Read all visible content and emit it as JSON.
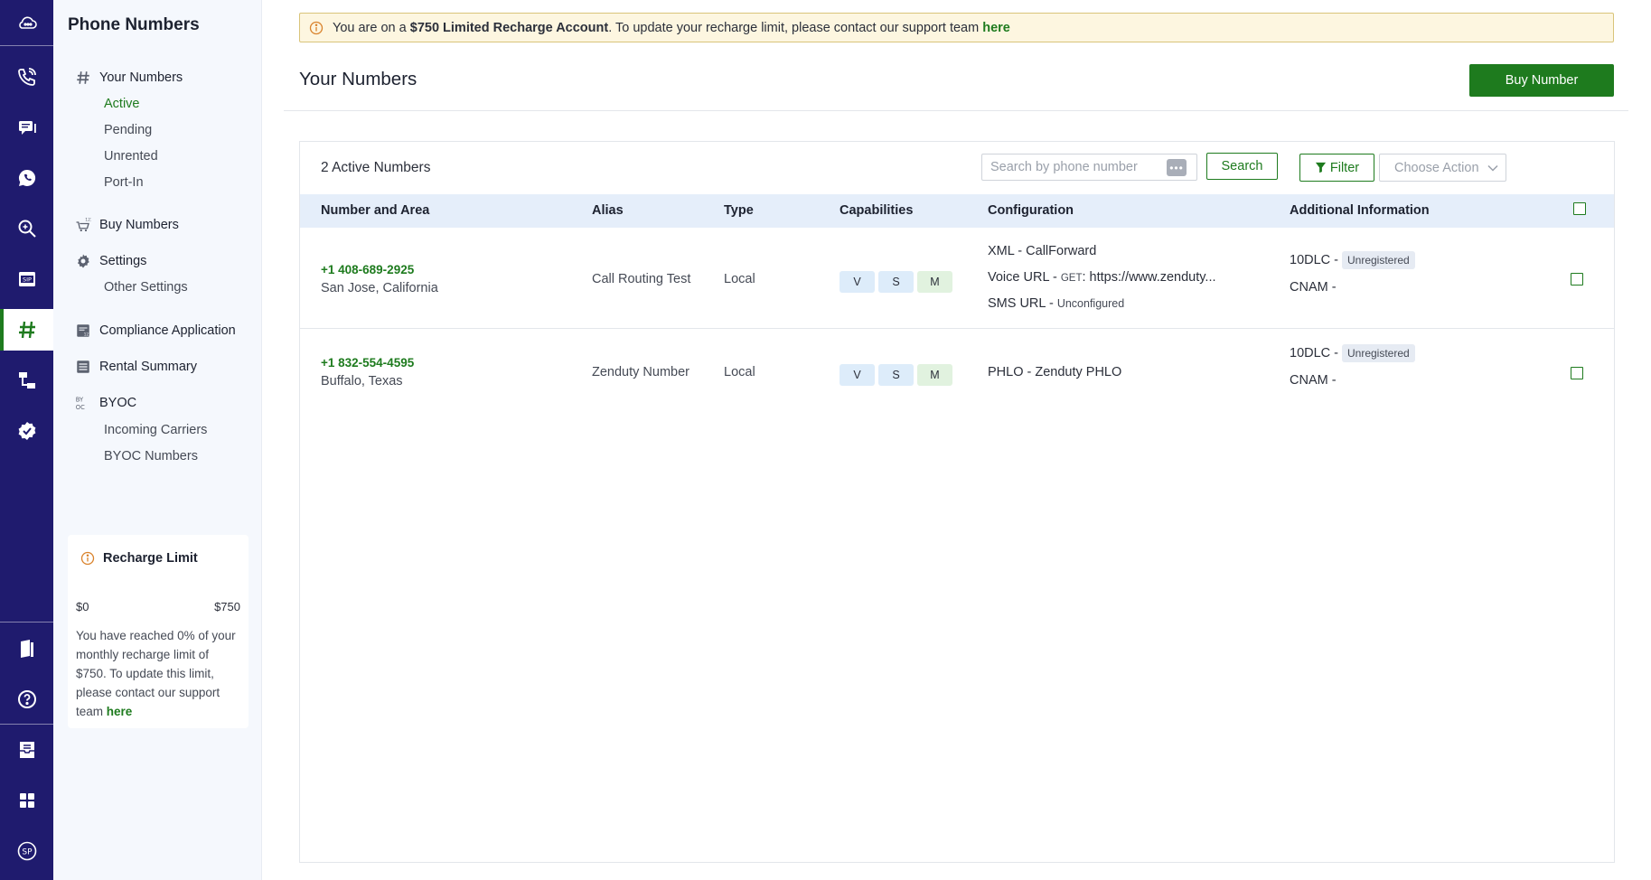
{
  "sidebar": {
    "title": "Phone Numbers",
    "sections": [
      {
        "label": "Your Numbers",
        "icon": "hash-icon"
      },
      {
        "label": "Buy Numbers",
        "icon": "cart-icon"
      },
      {
        "label": "Settings",
        "icon": "gear-icon"
      },
      {
        "label": "Compliance Application",
        "icon": "compliance-icon"
      },
      {
        "label": "Rental Summary",
        "icon": "list-icon"
      },
      {
        "label": "BYOC",
        "icon": "byoc-icon"
      }
    ],
    "sub_items": {
      "active": "Active",
      "pending": "Pending",
      "unrented": "Unrented",
      "port_in": "Port-In",
      "other_settings": "Other Settings",
      "incoming_carriers": "Incoming Carriers",
      "byoc_numbers": "BYOC Numbers"
    }
  },
  "recharge": {
    "title": "Recharge Limit",
    "min": "$0",
    "max": "$750",
    "used_percent": 0,
    "message": "You have reached 0% of your monthly recharge limit of $750. To update this limit, please contact our support team",
    "link": "here"
  },
  "banner": {
    "prefix": "You are on a",
    "bold": "$750 Limited Recharge Account",
    "suffix": ". To update your recharge limit, please contact our support team",
    "link": "here"
  },
  "page": {
    "title": "Your Numbers",
    "buy_button": "Buy Number"
  },
  "table": {
    "count_label": "2 Active Numbers",
    "search_placeholder": "Search by phone number",
    "search_button": "Search",
    "filter_button": "Filter",
    "action_placeholder": "Choose Action",
    "headers": {
      "number": "Number and Area",
      "alias": "Alias",
      "type": "Type",
      "capabilities": "Capabilities",
      "configuration": "Configuration",
      "additional": "Additional Information"
    },
    "rows": [
      {
        "number": "+1 408-689-2925",
        "location": "San Jose, California",
        "alias": "Call Routing Test",
        "type": "Local",
        "caps": [
          "V",
          "S",
          "M"
        ],
        "config": {
          "xml_label": "XML -",
          "xml_value": "CallForward",
          "voice_label": "Voice URL -",
          "voice_method": "GET",
          "voice_value": ": https://www.zenduty...",
          "sms_label": "SMS URL -",
          "sms_value": "Unconfigured"
        },
        "tendlc_label": "10DLC -",
        "tendlc_status": "Unregistered",
        "cnam": "CNAM -"
      },
      {
        "number": "+1 832-554-4595",
        "location": "Buffalo, Texas",
        "alias": "Zenduty Number",
        "type": "Local",
        "caps": [
          "V",
          "S",
          "M"
        ],
        "config": {
          "phlo": "PHLO - Zenduty PHLO"
        },
        "tendlc_label": "10DLC -",
        "tendlc_status": "Unregistered",
        "cnam": "CNAM -"
      }
    ]
  },
  "colors": {
    "rail": "#1f1b6e",
    "accent": "#1e7b1e",
    "header_bg": "#e5eefa",
    "banner_bg": "#fdf6e0"
  }
}
